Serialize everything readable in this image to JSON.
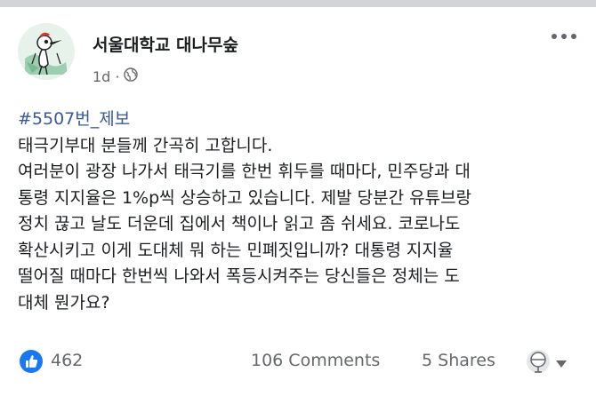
{
  "post": {
    "page_name": "서울대학교 대나무숲",
    "time": "1d",
    "separator": "·",
    "hashtag": "#5507번_제보",
    "lines": [
      "태극기부대 분들께 간곡히 고합니다.",
      "여러분이 광장 나가서 태극기를 한번 휘두를 때마다, 민주당과 대",
      "통령 지지율은 1%p씩 상승하고 있습니다. 제발 당분간 유튜브랑",
      "정치 끊고 날도 더운데 집에서 책이나 읽고 좀 쉬세요. 코로나도",
      "확산시키고 이게 도대체 뭐 하는 민폐짓입니까? 대통령 지지율",
      "떨어질 때마다 한번씩 나와서 폭등시켜주는 당신들은 정체는 도",
      "대체 뭔가요?"
    ]
  },
  "footer": {
    "likes": "462",
    "comments": "106 Comments",
    "shares": "5 Shares"
  },
  "icons": {
    "audience": "globe-icon",
    "like": "thumbs-up-icon",
    "more": "more-options-icon",
    "reaction": "reaction-globe-icon",
    "dropdown": "caret-down-icon"
  },
  "colors": {
    "hashtag": "#385898",
    "like_badge": "#1877f2",
    "secondary_text": "#65676b"
  }
}
